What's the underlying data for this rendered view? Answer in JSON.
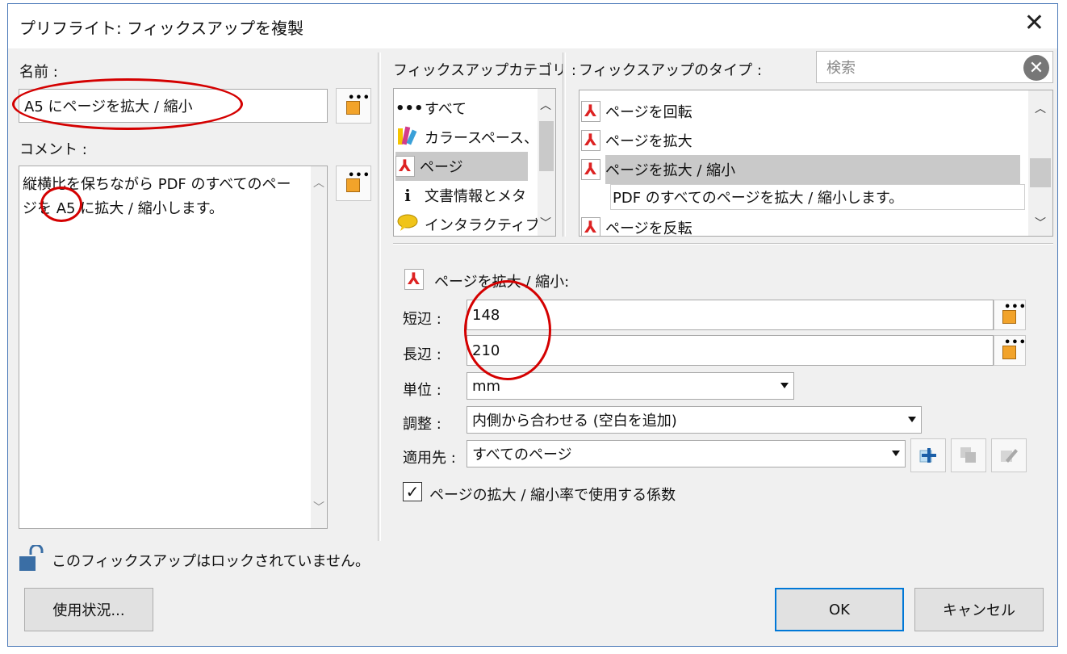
{
  "window": {
    "title": "プリフライト: フィックスアップを複製",
    "close_glyph": "✕"
  },
  "left": {
    "name_label": "名前 :",
    "name_value": "A5 にページを拡大 / 縮小",
    "comment_label": "コメント :",
    "comment_lines": [
      "縦横比を保ちながら PDF のすべてのペー",
      "ジを A5 に拡大 / 縮小します。"
    ],
    "lock_text": "このフィックスアップはロックされていません。",
    "usage_button": "使用状況..."
  },
  "categories": {
    "label": "フィックスアップカテゴリ :",
    "items": [
      {
        "label": "すべて",
        "icon": "dots-icon"
      },
      {
        "label": "カラースペース、特",
        "icon": "color-swatch-icon"
      },
      {
        "label": "ページ",
        "icon": "pdf-icon",
        "selected": true
      },
      {
        "label": "文書情報とメタ",
        "icon": "info-icon"
      },
      {
        "label": "インタラクティブか",
        "icon": "comment-icon"
      }
    ]
  },
  "types": {
    "label": "フィックスアップのタイプ :",
    "search_placeholder": "検索",
    "items": [
      {
        "label": "ページを回転"
      },
      {
        "label": "ページを拡大"
      },
      {
        "label": "ページを拡大 / 縮小",
        "selected": true
      },
      {
        "label": "PDF のすべてのページを拡大 / 縮小します。",
        "description": true
      },
      {
        "label": "ページを反転"
      }
    ]
  },
  "params": {
    "header": "ページを拡大 / 縮小:",
    "short_label": "短辺 :",
    "short_value": "148",
    "long_label": "長辺 :",
    "long_value": "210",
    "unit_label": "単位 :",
    "unit_value": "mm",
    "adjust_label": "調整 :",
    "adjust_value": "内側から合わせる (空白を追加)",
    "apply_label": "適用先 :",
    "apply_value": "すべてのページ",
    "checkbox_label": "ページの拡大 / 縮小率で使用する係数",
    "checkbox_checked": true
  },
  "footer": {
    "ok": "OK",
    "cancel": "キャンセル"
  },
  "colors": {
    "accent": "#0078d7",
    "annotation": "#d40000",
    "selection": "#c9c9c9"
  }
}
